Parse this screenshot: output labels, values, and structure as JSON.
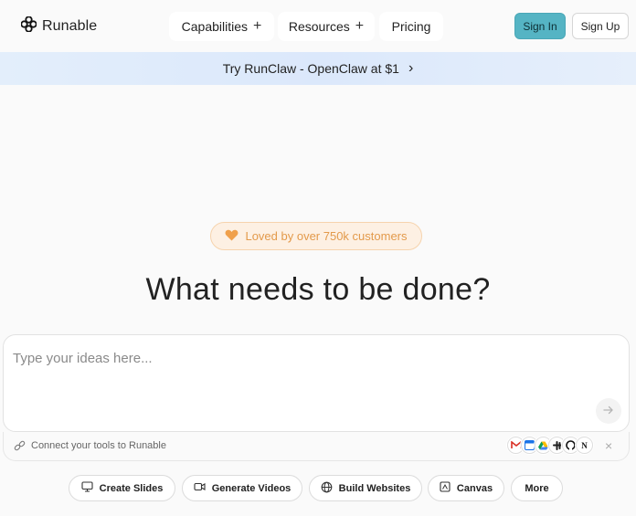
{
  "nav": {
    "brand": "Runable",
    "items": [
      {
        "label": "Capabilities",
        "has_plus": true
      },
      {
        "label": "Resources",
        "has_plus": true
      },
      {
        "label": "Pricing",
        "has_plus": false
      }
    ],
    "plus_glyph": "+",
    "sign_in": "Sign In",
    "sign_up": "Sign Up"
  },
  "banner": {
    "text": "Try RunClaw - OpenClaw at $1",
    "chevron": "›"
  },
  "badge": {
    "icon": "heart-icon",
    "text": "Loved by over 750k customers"
  },
  "headline": "What needs to be done?",
  "prompt": {
    "placeholder": "Type your ideas here...",
    "value": ""
  },
  "tools": {
    "connect_text": "Connect your tools to Runable",
    "integrations": [
      "gmail-icon",
      "calendar-icon",
      "drive-icon",
      "slack-icon",
      "github-icon",
      "notion-icon"
    ],
    "close_glyph": "×"
  },
  "chips": [
    {
      "label": "Create Slides",
      "icon": "slides-icon"
    },
    {
      "label": "Generate Videos",
      "icon": "video-icon"
    },
    {
      "label": "Build Websites",
      "icon": "globe-icon"
    },
    {
      "label": "Canvas",
      "icon": "canvas-icon"
    },
    {
      "label": "More",
      "icon": ""
    }
  ],
  "colors": {
    "accent": "#55b4c4",
    "badge_text": "#e39a4b",
    "banner_bg": "#dbe8fb"
  }
}
